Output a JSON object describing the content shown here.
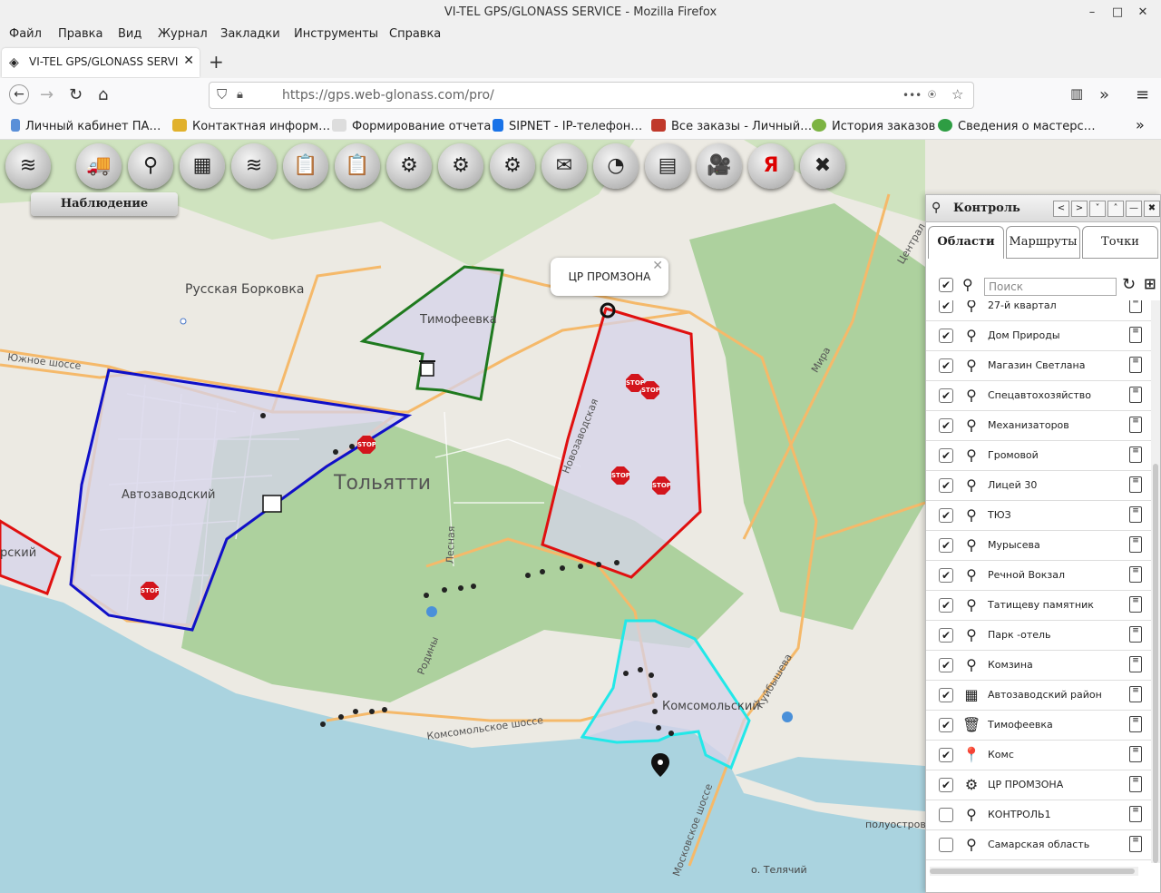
{
  "window": {
    "title": "VI-TEL GPS/GLONASS SERVICE - Mozilla Firefox",
    "minimize": "–",
    "maximize": "□",
    "close": "✕"
  },
  "menu": [
    "Файл",
    "Правка",
    "Вид",
    "Журнал",
    "Закладки",
    "Инструменты",
    "Справка"
  ],
  "tab": {
    "title": "VI-TEL GPS/GLONASS SERVI",
    "close": "✕",
    "new_tab": "+"
  },
  "nav": {
    "url": "https://gps.web-glonass.com/pro/",
    "more": "•••"
  },
  "bookmarks": [
    {
      "label": "Личный кабинет ПА…",
      "color": "#5a8fd8"
    },
    {
      "label": "Контактная информ…",
      "color": "#e1b12c"
    },
    {
      "label": "Формирование отчета",
      "color": "#ccc"
    },
    {
      "label": "SIPNET - IP-телефон…",
      "color": "#1a73e8"
    },
    {
      "label": "Все заказы - Личный…",
      "color": "#c0392b"
    },
    {
      "label": "История заказов",
      "color": "#7cb342"
    },
    {
      "label": "Сведения о мастерс…",
      "color": "#2e9d43"
    }
  ],
  "toolbar": {
    "buttons": [
      {
        "icon": "layers-icon",
        "glyph": "≋"
      },
      {
        "icon": "truck-icon",
        "glyph": "🚚"
      },
      {
        "icon": "route-icon",
        "glyph": "⚲"
      },
      {
        "icon": "map-icon",
        "glyph": "▦"
      },
      {
        "icon": "layers-alt-icon",
        "glyph": "≋"
      },
      {
        "icon": "report-icon",
        "glyph": "📋"
      },
      {
        "icon": "report-money-icon",
        "glyph": "📋"
      },
      {
        "icon": "settings-icon",
        "glyph": "⚙"
      },
      {
        "icon": "browser-settings-icon",
        "glyph": "⚙"
      },
      {
        "icon": "car-settings-icon",
        "glyph": "⚙"
      },
      {
        "icon": "message-icon",
        "glyph": "✉"
      },
      {
        "icon": "speedometer-icon",
        "glyph": "◔"
      },
      {
        "icon": "device-icon",
        "glyph": "▤"
      },
      {
        "icon": "camera-icon",
        "glyph": "🎥"
      },
      {
        "icon": "yandex-icon",
        "glyph": "Я"
      },
      {
        "icon": "tools-icon",
        "glyph": "✖"
      }
    ],
    "active_label": "Наблюдение"
  },
  "map": {
    "labels": {
      "russkaya_borkovka": "Русская Борковка",
      "timofeevka": "Тимофеевка",
      "togliatti": "Тольятти",
      "avtozavodsky": "Автозаводский",
      "komsomolsky": "Комсомольский",
      "rsky": "рский",
      "poluostrov": "полуостров",
      "telyachiy": "о. Телячий"
    },
    "roads": {
      "yuzhnoe": "Южное шоссе",
      "novozavodskaya": "Новозаводская",
      "lesnaya": "Лесная",
      "rodiny": "Родины",
      "komsomolskoe": "Комсомольское шоссе",
      "kuybysheva": "Куйбышева",
      "moskovskoe": "Московское шоссе",
      "mira": "Мира",
      "centralnaya": "Централ"
    },
    "popup": {
      "title": "ЦР ПРОМЗОНА",
      "close": "✕"
    },
    "stop_label": "STOP",
    "colors": {
      "water": "#aad3df",
      "forest": "#add19e",
      "zone_fill": "#d6d3ea",
      "zone_blue": "#1010c8",
      "zone_green": "#1f7a1f",
      "zone_red": "#e01010",
      "zone_cyan": "#22e8e8"
    }
  },
  "panel": {
    "title": "Контроль",
    "window_buttons": [
      "<",
      ">",
      "˅",
      "˄",
      "—",
      "✖"
    ],
    "tabs": [
      "Области",
      "Маршруты",
      "Точки"
    ],
    "active_tab": "Области",
    "search_placeholder": "Поиск",
    "select_all": true,
    "items": [
      {
        "label": "27-й квартал",
        "checked": true,
        "icon": "route-icon",
        "glyph": "⚲"
      },
      {
        "label": "Дом Природы",
        "checked": true,
        "icon": "route-icon",
        "glyph": "⚲"
      },
      {
        "label": "Магазин Светлана",
        "checked": true,
        "icon": "route-icon",
        "glyph": "⚲"
      },
      {
        "label": "Спецавтохозяйство",
        "checked": true,
        "icon": "route-icon",
        "glyph": "⚲"
      },
      {
        "label": "Механизаторов",
        "checked": true,
        "icon": "route-icon",
        "glyph": "⚲"
      },
      {
        "label": "Громовой",
        "checked": true,
        "icon": "route-icon",
        "glyph": "⚲"
      },
      {
        "label": "Лицей 30",
        "checked": true,
        "icon": "route-icon",
        "glyph": "⚲"
      },
      {
        "label": "ТЮЗ",
        "checked": true,
        "icon": "route-icon",
        "glyph": "⚲"
      },
      {
        "label": "Мурысева",
        "checked": true,
        "icon": "route-icon",
        "glyph": "⚲"
      },
      {
        "label": "Речной Вокзал",
        "checked": true,
        "icon": "route-icon",
        "glyph": "⚲"
      },
      {
        "label": "Татищеву памятник",
        "checked": true,
        "icon": "route-icon",
        "glyph": "⚲"
      },
      {
        "label": "Парк -отель",
        "checked": true,
        "icon": "route-icon",
        "glyph": "⚲"
      },
      {
        "label": "Комзина",
        "checked": true,
        "icon": "route-icon",
        "glyph": "⚲"
      },
      {
        "label": "Автозаводский район",
        "checked": true,
        "icon": "map-icon",
        "glyph": "▦"
      },
      {
        "label": "Тимофеевка",
        "checked": true,
        "icon": "trash-icon",
        "glyph": "🗑"
      },
      {
        "label": "Комс",
        "checked": true,
        "icon": "pin-icon",
        "glyph": "📍"
      },
      {
        "label": "ЦР ПРОМЗОНА",
        "checked": true,
        "icon": "gear-icon",
        "glyph": "⚙"
      },
      {
        "label": "КОНТРОЛЬ1",
        "checked": false,
        "icon": "route-icon",
        "glyph": "⚲"
      },
      {
        "label": "Самарская область",
        "checked": false,
        "icon": "route-icon",
        "glyph": "⚲"
      }
    ]
  }
}
